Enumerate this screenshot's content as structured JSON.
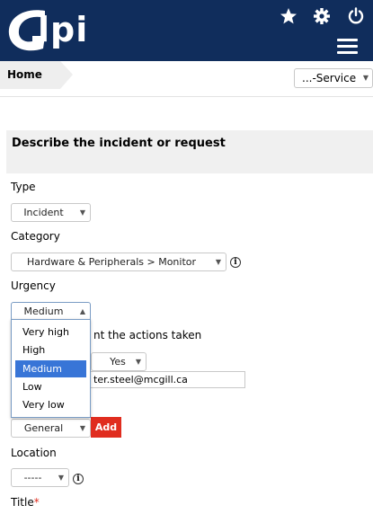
{
  "header": {
    "logo_text": "lpi",
    "logo_alt": "GLPI",
    "icons": [
      "star-icon",
      "gear-icon",
      "power-icon",
      "hamburger-menu-icon"
    ]
  },
  "breadcrumb": {
    "home_label": "Home"
  },
  "entity_select": {
    "value": "...-Service"
  },
  "form": {
    "title": "Describe the incident or request",
    "type_label": "Type",
    "type_value": "Incident",
    "category_label": "Category",
    "category_value": "Hardware & Peripherals > Monitor",
    "urgency_label": "Urgency",
    "urgency_value": "Medium",
    "urgency_options": [
      "Very high",
      "High",
      "Medium",
      "Low",
      "Very low"
    ],
    "urgency_selected": "Medium",
    "inform_partial": "nt the actions taken",
    "notify_value": "Yes",
    "email_partial": "ter.steel@mcgill.ca",
    "watcher_group_value": "General",
    "add_label": "Add",
    "location_label": "Location",
    "location_value": "-----",
    "title_label": "Title",
    "required_mark": "*"
  },
  "colors": {
    "topbar": "#102d5c",
    "accent_red": "#e02d1f",
    "selection_blue": "#3875d7"
  }
}
